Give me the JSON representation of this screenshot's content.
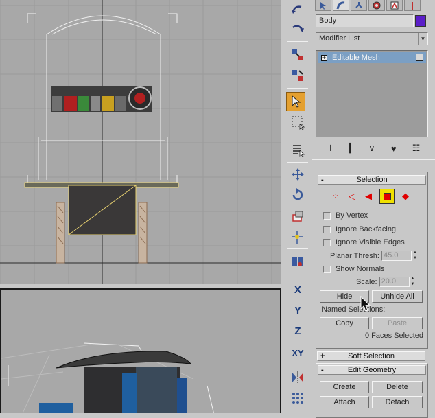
{
  "command_panel": {
    "tabs": [
      "create-tab",
      "modify-tab",
      "hierarchy-tab",
      "motion-tab",
      "display-tab",
      "utilities-tab"
    ],
    "object_name": "Body",
    "object_color": "#5a1ec8",
    "modifier_list": "Modifier List",
    "stack_item_label": "Editable Mesh",
    "stack_item_expand": "+"
  },
  "toolbar": {
    "x_label": "X",
    "y_label": "Y",
    "z_label": "Z",
    "xy_label": "XY"
  },
  "selection_rollout": {
    "sign": "-",
    "title": "Selection",
    "by_vertex": "By Vertex",
    "ignore_backfacing": "Ignore Backfacing",
    "ignore_visible_edges": "Ignore Visible Edges",
    "planar_thresh_label": "Planar Thresh:",
    "planar_thresh_value": "45.0",
    "show_normals": "Show Normals",
    "scale_label": "Scale:",
    "scale_value": "20.0",
    "hide": "Hide",
    "unhide_all": "Unhide All",
    "named_selections": "Named Selections:",
    "copy": "Copy",
    "paste": "Paste",
    "status": "0 Faces Selected"
  },
  "soft_selection_rollout": {
    "sign": "+",
    "title": "Soft Selection"
  },
  "edit_geometry_rollout": {
    "sign": "-",
    "title": "Edit Geometry",
    "create": "Create",
    "delete": "Delete",
    "attach": "Attach",
    "detach": "Detach"
  },
  "colors": {
    "active_tool": "#e4a030",
    "stack_highlight": "#7b9fc4",
    "selection_frame": "#d8c060"
  }
}
